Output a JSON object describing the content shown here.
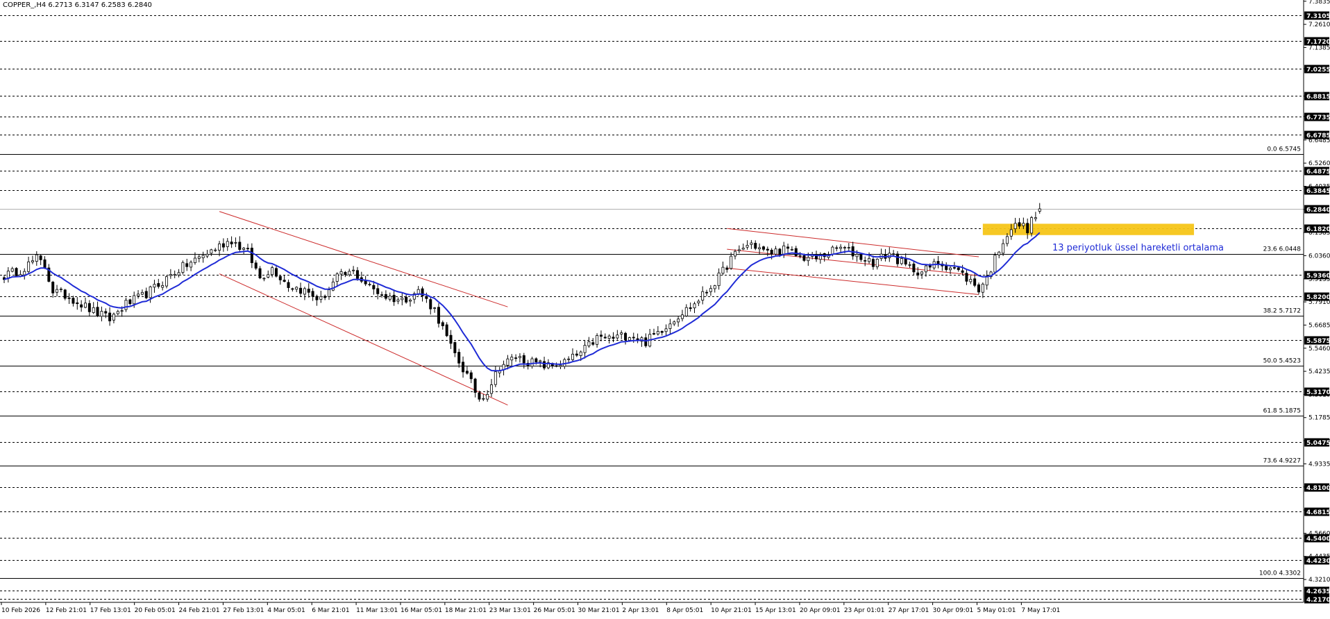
{
  "header": {
    "symbol_line": "COPPER_,H4  6.2713 6.3147 6.2583 6.2840"
  },
  "annotation": {
    "ema_label": "13 periyotluk üssel hareketli ortalama"
  },
  "colors": {
    "background": "#ffffff",
    "candle": "#000000",
    "ema_line": "#1f2bd6",
    "channel_lines": "#cc2a2a",
    "resistance_zone": "#f5c518",
    "grid": "#000000",
    "price_tag_bg": "#000000",
    "price_tag_text": "#ffffff"
  },
  "chart_data": {
    "type": "candlestick",
    "instrument": "COPPER_",
    "timeframe": "H4",
    "last": {
      "open": 6.2713,
      "high": 6.3147,
      "low": 6.2583,
      "close": 6.284
    },
    "ylim": [
      4.2,
      7.39
    ],
    "y_scale_labels": [
      "7.3835",
      "7.2610",
      "7.1385",
      "7.0255",
      "6.8815",
      "6.7735",
      "6.6485",
      "6.5260",
      "6.4035",
      "6.2810",
      "6.1585",
      "6.0360",
      "5.9135",
      "5.7910",
      "5.6685",
      "5.5460",
      "5.4235",
      "5.3010",
      "5.1785",
      "5.0560",
      "4.9335",
      "4.8110",
      "4.6885",
      "4.5660",
      "4.4435",
      "4.3210"
    ],
    "dashed_levels": [
      {
        "label": "7.3105",
        "value": 7.3105
      },
      {
        "label": "7.1720",
        "value": 7.172
      },
      {
        "label": "7.0255",
        "value": 7.0255
      },
      {
        "label": "6.8815",
        "value": 6.8815
      },
      {
        "label": "6.7735",
        "value": 6.7735
      },
      {
        "label": "6.6785",
        "value": 6.6785
      },
      {
        "label": "6.4875",
        "value": 6.4875
      },
      {
        "label": "6.3845",
        "value": 6.3845
      },
      {
        "label": "6.1820",
        "value": 6.182
      },
      {
        "label": "5.9360",
        "value": 5.936
      },
      {
        "label": "5.8200",
        "value": 5.82
      },
      {
        "label": "5.5875",
        "value": 5.5875
      },
      {
        "label": "5.3170",
        "value": 5.317
      },
      {
        "label": "5.0475",
        "value": 5.0475
      },
      {
        "label": "4.8100",
        "value": 4.81
      },
      {
        "label": "4.6815",
        "value": 4.6815
      },
      {
        "label": "4.5400",
        "value": 4.54
      },
      {
        "label": "4.4230",
        "value": 4.423
      },
      {
        "label": "4.2635",
        "value": 4.2635
      },
      {
        "label": "4.2170",
        "value": 4.217
      }
    ],
    "fib_levels": [
      {
        "label": "0.0 6.5745",
        "value": 6.5745
      },
      {
        "label": "23.6 6.0448",
        "value": 6.0448
      },
      {
        "label": "38.2 5.7172",
        "value": 5.7172
      },
      {
        "label": "50.0 5.4523",
        "value": 5.4523
      },
      {
        "label": "61.8 5.1875",
        "value": 5.1875
      },
      {
        "label": "73.6 4.9227",
        "value": 4.9227
      },
      {
        "label": "100.0 4.3302",
        "value": 4.3302
      }
    ],
    "current_price": {
      "label": "6.2840",
      "value": 6.284
    },
    "resistance_zone": {
      "from_index": 241,
      "to_index": 293,
      "top": 6.205,
      "bottom": 6.145
    },
    "x_labels": [
      "10 Feb 2026",
      "12 Feb 21:01",
      "17 Feb 13:01",
      "20 Feb 05:01",
      "24 Feb 21:01",
      "27 Feb 13:01",
      "4 Mar 05:01",
      "6 Mar 21:01",
      "11 Mar 13:01",
      "16 Mar 05:01",
      "18 Mar 21:01",
      "23 Mar 13:01",
      "26 Mar 05:01",
      "30 Mar 21:01",
      "2 Apr 13:01",
      "8 Apr 05:01",
      "10 Apr 21:01",
      "15 Apr 13:01",
      "20 Apr 09:01",
      "23 Apr 01:01",
      "27 Apr 17:01",
      "30 Apr 09:01",
      "5 May 01:01",
      "7 May 17:01"
    ],
    "price_anchors": [
      [
        0,
        5.93
      ],
      [
        4,
        5.96
      ],
      [
        8,
        6.02
      ],
      [
        10,
        5.98
      ],
      [
        12,
        5.85
      ],
      [
        16,
        5.82
      ],
      [
        22,
        5.74
      ],
      [
        26,
        5.7
      ],
      [
        30,
        5.78
      ],
      [
        34,
        5.82
      ],
      [
        38,
        5.88
      ],
      [
        42,
        5.95
      ],
      [
        46,
        6.0
      ],
      [
        50,
        6.05
      ],
      [
        54,
        6.1
      ],
      [
        56,
        6.12
      ],
      [
        60,
        6.05
      ],
      [
        63,
        5.92
      ],
      [
        66,
        5.97
      ],
      [
        70,
        5.88
      ],
      [
        74,
        5.85
      ],
      [
        78,
        5.8
      ],
      [
        82,
        5.92
      ],
      [
        86,
        5.95
      ],
      [
        90,
        5.87
      ],
      [
        94,
        5.82
      ],
      [
        98,
        5.8
      ],
      [
        102,
        5.85
      ],
      [
        106,
        5.75
      ],
      [
        110,
        5.55
      ],
      [
        114,
        5.4
      ],
      [
        117,
        5.28
      ],
      [
        119,
        5.32
      ],
      [
        122,
        5.45
      ],
      [
        126,
        5.5
      ],
      [
        130,
        5.47
      ],
      [
        134,
        5.45
      ],
      [
        138,
        5.47
      ],
      [
        142,
        5.52
      ],
      [
        146,
        5.6
      ],
      [
        150,
        5.6
      ],
      [
        154,
        5.62
      ],
      [
        158,
        5.58
      ],
      [
        162,
        5.65
      ],
      [
        166,
        5.72
      ],
      [
        170,
        5.78
      ],
      [
        173,
        5.85
      ],
      [
        176,
        5.92
      ],
      [
        179,
        6.02
      ],
      [
        182,
        6.08
      ],
      [
        184,
        6.1
      ],
      [
        188,
        6.05
      ],
      [
        192,
        6.07
      ],
      [
        196,
        6.03
      ],
      [
        200,
        6.02
      ],
      [
        203,
        6.05
      ],
      [
        206,
        6.08
      ],
      [
        210,
        6.04
      ],
      [
        214,
        6.0
      ],
      [
        218,
        6.05
      ],
      [
        222,
        5.98
      ],
      [
        226,
        5.95
      ],
      [
        230,
        6.0
      ],
      [
        234,
        5.97
      ],
      [
        238,
        5.9
      ],
      [
        240,
        5.86
      ],
      [
        242,
        5.92
      ],
      [
        244,
        6.02
      ],
      [
        246,
        6.12
      ],
      [
        248,
        6.18
      ],
      [
        250,
        6.2
      ],
      [
        252,
        6.18
      ],
      [
        254,
        6.25
      ],
      [
        255,
        6.284
      ]
    ],
    "ema_period": 13,
    "channels": [
      {
        "name": "ch1_top",
        "from": [
          53,
          6.27
        ],
        "to": [
          124,
          5.765
        ]
      },
      {
        "name": "ch1_bottom",
        "from": [
          53,
          5.94
        ],
        "to": [
          124,
          5.245
        ]
      },
      {
        "name": "ch2_top",
        "from": [
          178,
          6.18
        ],
        "to": [
          240,
          6.03
        ]
      },
      {
        "name": "ch2_bottom",
        "from": [
          178,
          5.97
        ],
        "to": [
          240,
          5.83
        ]
      },
      {
        "name": "ch2_mid",
        "from": [
          178,
          6.07
        ],
        "to": [
          240,
          5.93
        ]
      }
    ],
    "grid": false,
    "legend": "none"
  }
}
